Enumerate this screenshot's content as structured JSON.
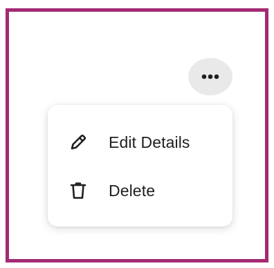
{
  "header": {
    "more_button": {
      "icon": "more-horizontal-icon"
    }
  },
  "menu": {
    "items": [
      {
        "label": "Edit Details",
        "icon": "pencil-icon"
      },
      {
        "label": "Delete",
        "icon": "trash-icon"
      }
    ]
  },
  "colors": {
    "frame_border": "#a32a72",
    "button_bg": "#e9e9e9",
    "text": "#1f1f1f"
  }
}
